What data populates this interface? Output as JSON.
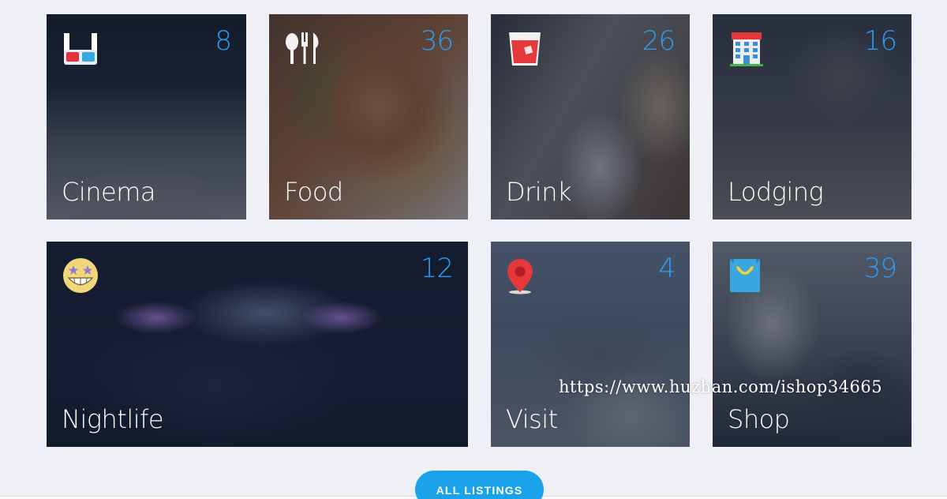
{
  "categories": [
    {
      "name": "Cinema",
      "count": "8",
      "icon": "3d-glasses-icon"
    },
    {
      "name": "Food",
      "count": "36",
      "icon": "cutlery-icon"
    },
    {
      "name": "Drink",
      "count": "26",
      "icon": "drink-glass-icon"
    },
    {
      "name": "Lodging",
      "count": "16",
      "icon": "hotel-building-icon"
    },
    {
      "name": "Nightlife",
      "count": "12",
      "icon": "star-eyes-emoji-icon"
    },
    {
      "name": "Visit",
      "count": "4",
      "icon": "map-pin-icon"
    },
    {
      "name": "Shop",
      "count": "39",
      "icon": "shopping-bag-icon"
    }
  ],
  "watermark": "https://www.huzhan.com/ishop34665",
  "all_listings_label": "ALL LISTINGS",
  "colors": {
    "page_background": "#eef0f5",
    "count_text": "#2e9bf0",
    "button": "#1aa3ea"
  }
}
